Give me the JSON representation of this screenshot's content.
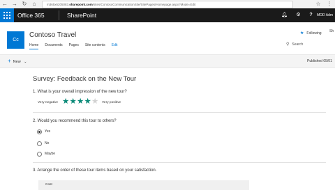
{
  "browser": {
    "url_prefix": "m365x6205083.",
    "url_host": "sharepoint.com",
    "url_rest": "/sites/ContosoCommunicationSite/SitePages/Homepage.aspx?Mode=Edit"
  },
  "suitebar": {
    "app_name": "Office 365",
    "product_name": "SharePoint",
    "user_name": "MOD Adm"
  },
  "site": {
    "logo_text": "Cc",
    "title": "Contoso Travel",
    "nav": [
      "Home",
      "Documents",
      "Pages",
      "Site contents",
      "Edit"
    ],
    "follow_label": "Following",
    "share_label": "Sh",
    "search_placeholder": "Search"
  },
  "command_bar": {
    "new_label": "New",
    "published": "Published 05/01"
  },
  "survey": {
    "title": "Survey: Feedback on the New Tour",
    "q1": {
      "text": "1. What is your overall impression of the new tour?",
      "low_label": "Very negative",
      "high_label": "Very positive",
      "rating": 4,
      "max_rating": 5,
      "filled_color": "#0b8a78",
      "empty_color": "#d2d2d2"
    },
    "q2": {
      "text": "2. Would you recommend this tour to others?",
      "options": [
        "Yes",
        "No",
        "Maybe"
      ],
      "selected": "Yes"
    },
    "q3": {
      "text": "3. Arrange the order of these tour items based on your satisfaction.",
      "items": [
        "Cost"
      ]
    }
  }
}
